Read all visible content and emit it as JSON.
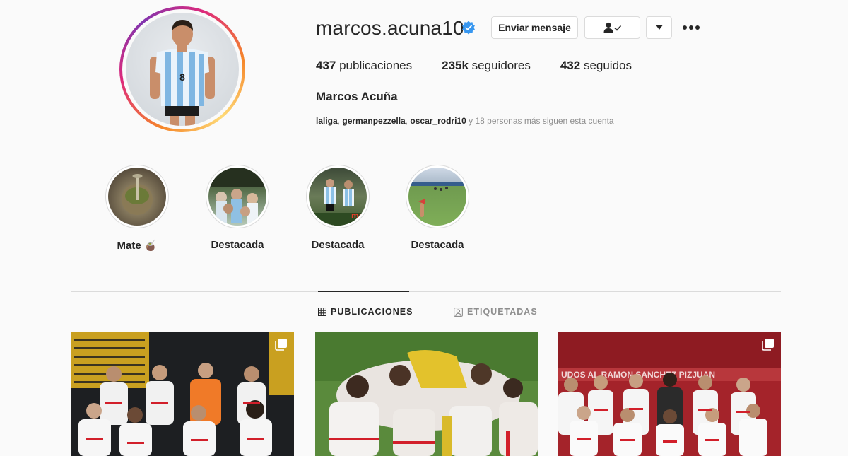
{
  "profile": {
    "username": "marcos.acuna10",
    "verified": true,
    "full_name": "Marcos Acuña",
    "followed_by": {
      "accounts": [
        "laliga",
        "germanpezzella",
        "oscar_rodri10"
      ],
      "sep1": ", ",
      "sep2": ", ",
      "rest": " y 18 personas más siguen esta cuenta"
    }
  },
  "actions": {
    "message_label": "Enviar mensaje",
    "follow_icon": "person-check-icon",
    "dropdown_icon": "caret-down-icon",
    "more_icon": "more-dots-icon"
  },
  "stats": {
    "posts_count": "437",
    "posts_label": " publicaciones",
    "followers_count": "235k",
    "followers_label": " seguidores",
    "following_count": "432",
    "following_label": " seguidos"
  },
  "highlights": [
    {
      "label": "Mate 🧉"
    },
    {
      "label": "Destacada"
    },
    {
      "label": "Destacada"
    },
    {
      "label": "Destacada"
    }
  ],
  "tabs": [
    {
      "label": "PUBLICACIONES",
      "icon": "grid-icon",
      "active": true
    },
    {
      "label": "ETIQUETADAS",
      "icon": "tagged-person-icon",
      "active": false
    }
  ],
  "posts": [
    {
      "multiple": true
    },
    {
      "multiple": false
    },
    {
      "multiple": true
    }
  ],
  "colors": {
    "verified_blue": "#3897f0",
    "text": "#262626",
    "muted": "#8e8e8e",
    "border": "#dbdbdb",
    "background": "#fafafa"
  }
}
